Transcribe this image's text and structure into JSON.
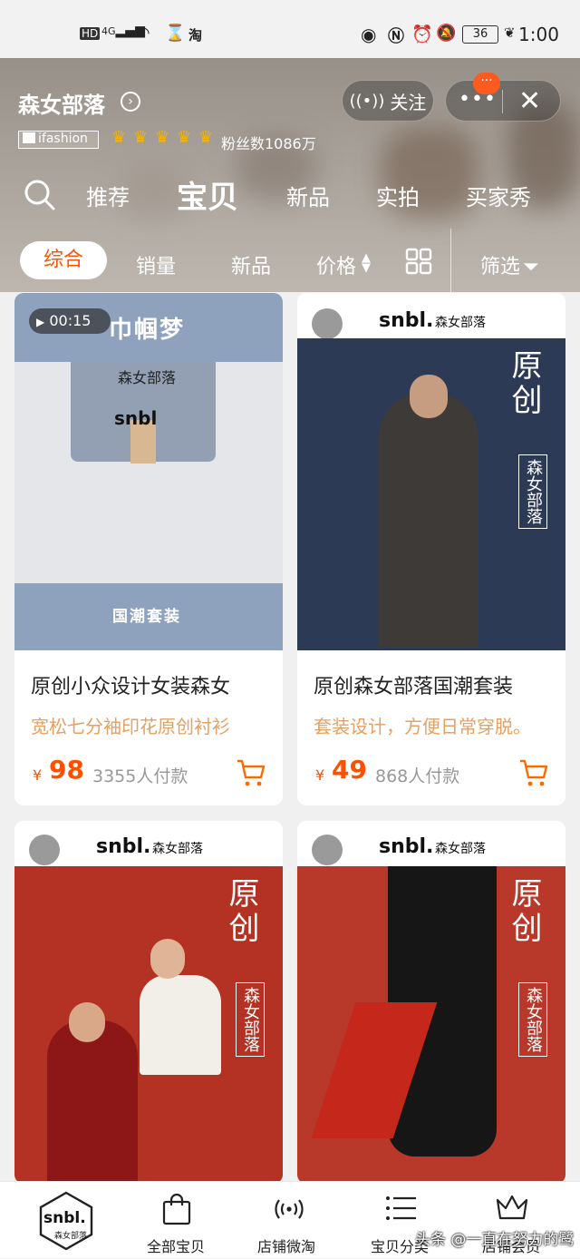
{
  "status_bar": {
    "left_icons": [
      "hd-icon",
      "4g-signal-icon",
      "wifi-icon",
      "hourglass-icon",
      "taobao-icon"
    ],
    "hd": "HD",
    "net": "4G",
    "taobao": "淘",
    "battery": "36",
    "time": "1:00"
  },
  "shop": {
    "name": "森女部落",
    "ifashion": "ifashion",
    "fans": "粉丝数1086万",
    "follow_label": "关注",
    "menu_badge": "···"
  },
  "tabs": [
    "推荐",
    "宝贝",
    "新品",
    "实拍",
    "买家秀"
  ],
  "active_tab": "宝贝",
  "filters": {
    "comprehensive": "综合",
    "sales": "销量",
    "new": "新品",
    "price": "价格",
    "screen": "筛选"
  },
  "products": [
    {
      "video_duration": "00:15",
      "banner_top": "巾帼梦",
      "banner_bottom": "国潮套装",
      "package_logo": "snbl",
      "package_text": "森女部落",
      "title": "原创小众设计女装森女",
      "subtitle": "宽松七分袖印花原创衬衫",
      "currency": "¥",
      "price": "98",
      "sold": "3355人付款",
      "bg": "#8ea2bd"
    },
    {
      "brand_logo": "snbl.",
      "brand_text": "森女部落",
      "poster_title": "原创",
      "poster_brand": "森女部落",
      "title": "原创森女部落国潮套装",
      "subtitle": "套装设计，方便日常穿脱。",
      "currency": "¥",
      "price": "49",
      "sold": "868人付款",
      "bg": "#2c3a55"
    },
    {
      "brand_logo": "snbl.",
      "brand_text": "森女部落",
      "poster_title": "原创",
      "poster_brand": "森女部落",
      "bg": "#b43223"
    },
    {
      "brand_logo": "snbl.",
      "brand_text": "森女部落",
      "poster_title": "原创",
      "poster_brand": "森女部落",
      "bg": "#b8382a"
    }
  ],
  "bottom_nav": {
    "logo": "snbl.",
    "logo_sub": "森女部落",
    "items": [
      "全部宝贝",
      "店铺微淘",
      "宝贝分类",
      "店铺会员"
    ]
  },
  "watermark": "头条 @一直在努力的鹭"
}
